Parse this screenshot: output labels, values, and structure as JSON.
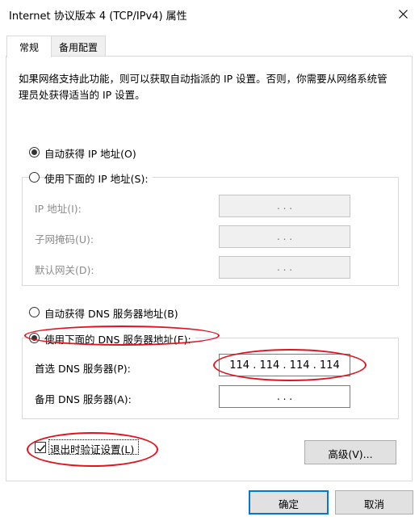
{
  "window": {
    "title": "Internet 协议版本 4 (TCP/IPv4) 属性"
  },
  "tabs": [
    {
      "label": "常规"
    },
    {
      "label": "备用配置"
    }
  ],
  "description": "如果网络支持此功能，则可以获取自动指派的 IP 设置。否则，你需要从网络系统管理员处获得适当的 IP 设置。",
  "ip": {
    "auto_label": "自动获得 IP 地址(O)",
    "manual_label": "使用下面的 IP 地址(S):",
    "address_label": "IP 地址(I):",
    "subnet_label": "子网掩码(U):",
    "gateway_label": "默认网关(D):",
    "empty_value": ".     .     ."
  },
  "dns": {
    "auto_label": "自动获得 DNS 服务器地址(B)",
    "manual_label": "使用下面的 DNS 服务器地址(E):",
    "preferred_label": "首选 DNS 服务器(P):",
    "preferred_value": "114 . 114 . 114 . 114",
    "alternate_label": "备用 DNS 服务器(A):",
    "alternate_value": ".     .     ."
  },
  "validate_label": "退出时验证设置(L)",
  "advanced_label": "高级(V)...",
  "ok_label": "确定",
  "cancel_label": "取消",
  "colors": {
    "annotation": "#e0141e",
    "default_button_border": "#0078d7"
  }
}
